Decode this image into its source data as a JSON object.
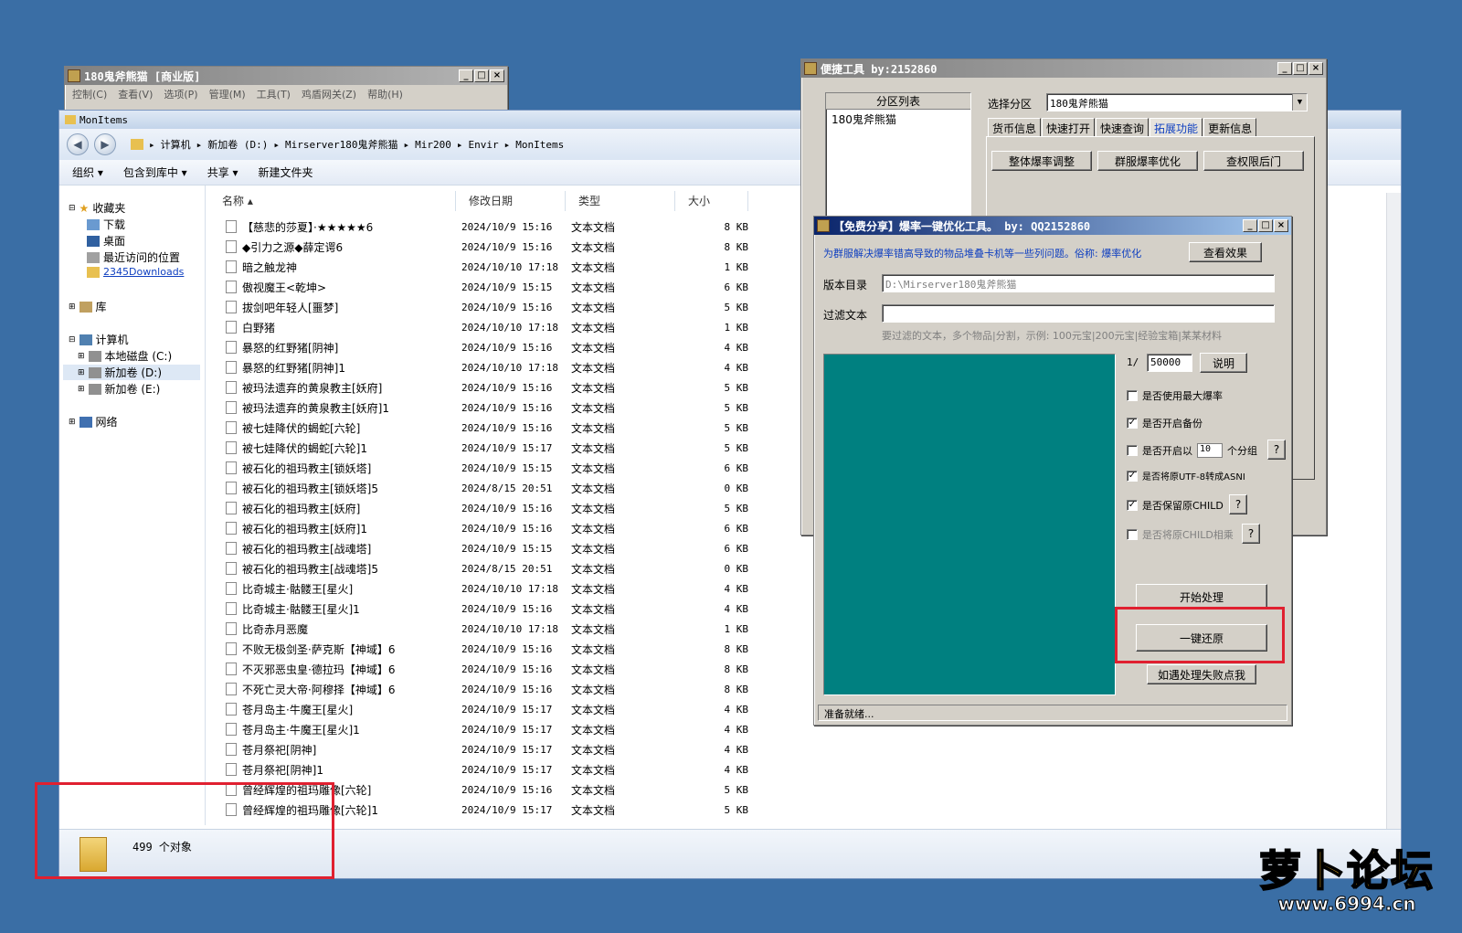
{
  "back_window": {
    "title": "180鬼斧熊猫 [商业版]",
    "menu": [
      "控制(C)",
      "查看(V)",
      "选项(P)",
      "管理(M)",
      "工具(T)",
      "鸡盾网关(Z)",
      "帮助(H)"
    ]
  },
  "explorer": {
    "title": "MonItems",
    "breadcrumb": [
      "计算机",
      "新加卷 (D:)",
      "Mirserver180鬼斧熊猫",
      "Mir200",
      "Envir",
      "MonItems"
    ],
    "commands": [
      "组织 ▾",
      "包含到库中 ▾",
      "共享 ▾",
      "新建文件夹"
    ],
    "nav": {
      "favorites": "收藏夹",
      "downloads": "下载",
      "desktop": "桌面",
      "recent": "最近访问的位置",
      "downloads2345": "2345Downloads",
      "libraries": "库",
      "computer": "计算机",
      "drive_c": "本地磁盘 (C:)",
      "drive_d": "新加卷 (D:)",
      "drive_e": "新加卷 (E:)",
      "network": "网络"
    },
    "columns": {
      "name": "名称",
      "date": "修改日期",
      "type": "类型",
      "size": "大小"
    },
    "files": [
      {
        "name": "【慈悲的莎夏】·★★★★★6",
        "date": "2024/10/9 15:16",
        "type": "文本文档",
        "size": "8 KB"
      },
      {
        "name": "◆引力之源◆薛定谔6",
        "date": "2024/10/9 15:16",
        "type": "文本文档",
        "size": "8 KB"
      },
      {
        "name": "暗之触龙神",
        "date": "2024/10/10 17:18",
        "type": "文本文档",
        "size": "1 KB"
      },
      {
        "name": "傲视魔王<乾坤>",
        "date": "2024/10/9 15:15",
        "type": "文本文档",
        "size": "6 KB"
      },
      {
        "name": "拔剑吧年轻人[噩梦]",
        "date": "2024/10/9 15:16",
        "type": "文本文档",
        "size": "5 KB"
      },
      {
        "name": "白野猪",
        "date": "2024/10/10 17:18",
        "type": "文本文档",
        "size": "1 KB"
      },
      {
        "name": "暴怒的红野猪[阴神]",
        "date": "2024/10/9 15:16",
        "type": "文本文档",
        "size": "4 KB"
      },
      {
        "name": "暴怒的红野猪[阴神]1",
        "date": "2024/10/10 17:18",
        "type": "文本文档",
        "size": "4 KB"
      },
      {
        "name": "被玛法遗弃的黄泉教主[妖府]",
        "date": "2024/10/9 15:16",
        "type": "文本文档",
        "size": "5 KB"
      },
      {
        "name": "被玛法遗弃的黄泉教主[妖府]1",
        "date": "2024/10/9 15:16",
        "type": "文本文档",
        "size": "5 KB"
      },
      {
        "name": "被七娃降伏的蝎蛇[六轮]",
        "date": "2024/10/9 15:16",
        "type": "文本文档",
        "size": "5 KB"
      },
      {
        "name": "被七娃降伏的蝎蛇[六轮]1",
        "date": "2024/10/9 15:17",
        "type": "文本文档",
        "size": "5 KB"
      },
      {
        "name": "被石化的祖玛教主[锁妖塔]",
        "date": "2024/10/9 15:15",
        "type": "文本文档",
        "size": "6 KB"
      },
      {
        "name": "被石化的祖玛教主[锁妖塔]5",
        "date": "2024/8/15 20:51",
        "type": "文本文档",
        "size": "0 KB"
      },
      {
        "name": "被石化的祖玛教主[妖府]",
        "date": "2024/10/9 15:16",
        "type": "文本文档",
        "size": "5 KB"
      },
      {
        "name": "被石化的祖玛教主[妖府]1",
        "date": "2024/10/9 15:16",
        "type": "文本文档",
        "size": "6 KB"
      },
      {
        "name": "被石化的祖玛教主[战魂塔]",
        "date": "2024/10/9 15:15",
        "type": "文本文档",
        "size": "6 KB"
      },
      {
        "name": "被石化的祖玛教主[战魂塔]5",
        "date": "2024/8/15 20:51",
        "type": "文本文档",
        "size": "0 KB"
      },
      {
        "name": "比奇城主·骷髅王[星火]",
        "date": "2024/10/10 17:18",
        "type": "文本文档",
        "size": "4 KB"
      },
      {
        "name": "比奇城主·骷髅王[星火]1",
        "date": "2024/10/9 15:16",
        "type": "文本文档",
        "size": "4 KB"
      },
      {
        "name": "比奇赤月恶魔",
        "date": "2024/10/10 17:18",
        "type": "文本文档",
        "size": "1 KB"
      },
      {
        "name": "不败无极剑圣·萨克斯【神域】6",
        "date": "2024/10/9 15:16",
        "type": "文本文档",
        "size": "8 KB"
      },
      {
        "name": "不灭邪恶虫皇·德拉玛【神域】6",
        "date": "2024/10/9 15:16",
        "type": "文本文档",
        "size": "8 KB"
      },
      {
        "name": "不死亡灵大帝·阿穆择【神域】6",
        "date": "2024/10/9 15:16",
        "type": "文本文档",
        "size": "8 KB"
      },
      {
        "name": "苍月岛主·牛魔王[星火]",
        "date": "2024/10/9 15:17",
        "type": "文本文档",
        "size": "4 KB"
      },
      {
        "name": "苍月岛主·牛魔王[星火]1",
        "date": "2024/10/9 15:17",
        "type": "文本文档",
        "size": "4 KB"
      },
      {
        "name": "苍月祭祀[阴神]",
        "date": "2024/10/9 15:17",
        "type": "文本文档",
        "size": "4 KB"
      },
      {
        "name": "苍月祭祀[阴神]1",
        "date": "2024/10/9 15:17",
        "type": "文本文档",
        "size": "4 KB"
      },
      {
        "name": "曾经辉煌的祖玛雕像[六轮]",
        "date": "2024/10/9 15:16",
        "type": "文本文档",
        "size": "5 KB"
      },
      {
        "name": "曾经辉煌的祖玛雕像[六轮]1",
        "date": "2024/10/9 15:17",
        "type": "文本文档",
        "size": "5 KB"
      }
    ],
    "status": "499 个对象"
  },
  "quicktool": {
    "title": "便捷工具  by:2152860",
    "partition_header": "分区列表",
    "partition_item": "180鬼斧熊猫",
    "select_label": "选择分区",
    "select_value": "180鬼斧熊猫",
    "tabs": [
      "货币信息",
      "快速打开",
      "快速查询",
      "拓展功能",
      "更新信息"
    ],
    "buttons": [
      "整体爆率调整",
      "群服爆率优化",
      "查权限后门"
    ]
  },
  "optimizer": {
    "title": "【免费分享】爆率一键优化工具。   by: QQ2152860",
    "desc": "为群服解决爆率错高导致的物品堆叠卡机等一些列问题。俗称: 爆率优化",
    "view_effect": "查看效果",
    "version_label": "版本目录",
    "version_value": "D:\\Mirserver180鬼斧熊猫",
    "filter_label": "过滤文本",
    "filter_value": "",
    "hint": "要过滤的文本，多个物品|分割，示例: 100元宝|200元宝|经验宝箱|某某材料",
    "ratio_prefix": "1/",
    "ratio_value": "50000",
    "explain": "说明",
    "opt_max": "是否使用最大爆率",
    "opt_backup": "是否开启备份",
    "opt_group_pre": "是否开启以",
    "opt_group_value": "10",
    "opt_group_post": "个分组",
    "opt_utf8": "是否将原UTF-8转成ASNI",
    "opt_child": "是否保留原CHILD",
    "opt_child_mul": "是否将原CHILD相乘",
    "q": "?",
    "start": "开始处理",
    "restore": "一键还原",
    "failed": "如遇处理失败点我",
    "status": "准备就绪..."
  },
  "watermark": {
    "name": "萝卜论坛",
    "url": "www.6994.cn"
  }
}
